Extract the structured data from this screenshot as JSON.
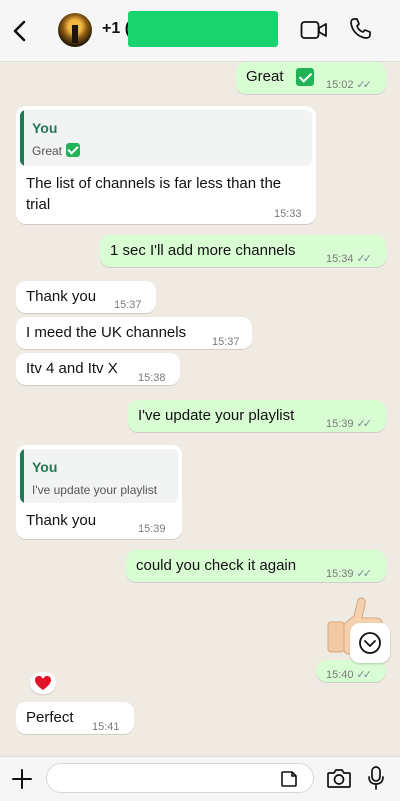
{
  "header": {
    "contact_name": "+1 (",
    "icons": {
      "back": "chevron-left-icon",
      "video": "video-camera-icon",
      "phone": "phone-icon"
    }
  },
  "messages": [
    {
      "type": "outgoing",
      "text": "Great",
      "emoji": "check-mark",
      "time": "15:02",
      "ticks": "✓✓"
    },
    {
      "type": "incoming-reply",
      "quote_author": "You",
      "quote_text": "Great",
      "quote_emoji": "check-mark",
      "text_line1": "The list of channels is far less than the",
      "text_line2": "trial",
      "time": "15:33"
    },
    {
      "type": "outgoing",
      "text": "1 sec I'll add more channels",
      "time": "15:34",
      "ticks": "✓✓"
    },
    {
      "type": "incoming",
      "text": "Thank you",
      "time": "15:37"
    },
    {
      "type": "incoming",
      "text": "I meed the UK channels",
      "time": "15:37"
    },
    {
      "type": "incoming",
      "text": "Itv 4 and Itv X",
      "time": "15:38"
    },
    {
      "type": "outgoing",
      "text": "I've update your playlist",
      "time": "15:39",
      "ticks": "✓✓"
    },
    {
      "type": "incoming-reply",
      "quote_author": "You",
      "quote_text": "I've update your playlist",
      "text": "Thank you",
      "time": "15:39"
    },
    {
      "type": "outgoing",
      "text": "could you check it again",
      "time": "15:39",
      "ticks": "✓✓"
    },
    {
      "type": "outgoing-sticker",
      "emoji": "thumbs-up",
      "time": "15:40",
      "ticks": "✓✓"
    },
    {
      "type": "incoming",
      "text": "Perfect",
      "time": "15:41",
      "reaction": "red-heart"
    }
  ],
  "footer": {
    "placeholder": "",
    "icons": {
      "attach": "plus-icon",
      "sticker": "sticker-icon",
      "camera": "camera-icon",
      "mic": "microphone-icon"
    }
  },
  "colors": {
    "outgoing_bubble": "#d9fdd3",
    "incoming_bubble": "#ffffff",
    "quote_accent": "#1f7a55",
    "background": "#efeae2"
  }
}
